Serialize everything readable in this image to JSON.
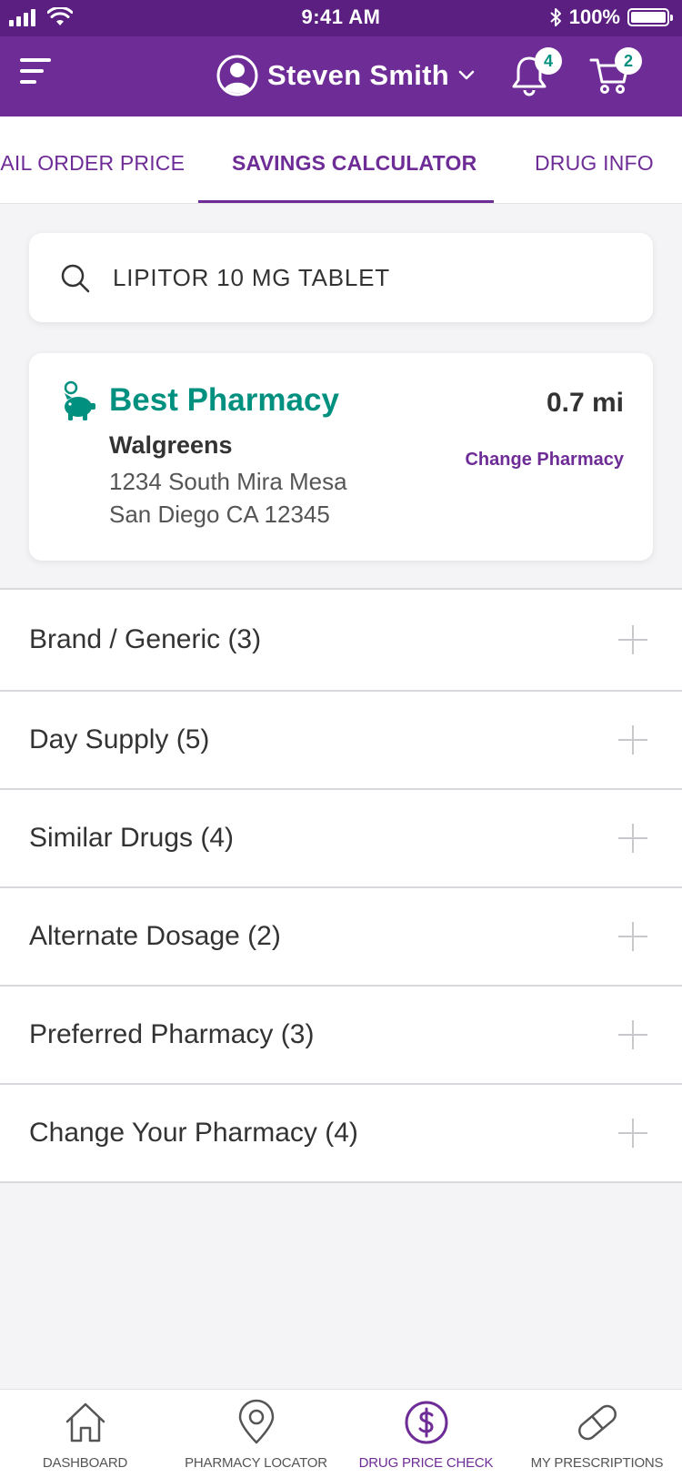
{
  "status_bar": {
    "time": "9:41 AM",
    "battery": "100%"
  },
  "header": {
    "user_name": "Steven Smith",
    "notification_count": "4",
    "cart_count": "2"
  },
  "tabs": [
    {
      "label": "MAIL ORDER PRICE",
      "active": false
    },
    {
      "label": "SAVINGS CALCULATOR",
      "active": true
    },
    {
      "label": "DRUG INFO",
      "active": false
    }
  ],
  "search": {
    "value": "LIPITOR 10 MG TABLET"
  },
  "pharmacy": {
    "heading": "Best Pharmacy",
    "distance": "0.7 mi",
    "name": "Walgreens",
    "address_line1": "1234 South Mira Mesa",
    "address_line2": "San Diego CA 12345",
    "change_label": "Change Pharmacy"
  },
  "accordion": [
    {
      "label": "Brand / Generic (3)"
    },
    {
      "label": "Day Supply (5)"
    },
    {
      "label": "Similar Drugs (4)"
    },
    {
      "label": "Alternate Dosage (2)"
    },
    {
      "label": "Preferred Pharmacy (3)"
    },
    {
      "label": "Change Your Pharmacy (4)"
    }
  ],
  "bottom_nav": [
    {
      "label": "DASHBOARD",
      "icon": "home-icon",
      "active": false
    },
    {
      "label": "PHARMACY LOCATOR",
      "icon": "location-pin-icon",
      "active": false
    },
    {
      "label": "DRUG PRICE CHECK",
      "icon": "dollar-circle-icon",
      "active": true
    },
    {
      "label": "MY PRESCRIPTIONS",
      "icon": "pill-icon",
      "active": false
    }
  ],
  "colors": {
    "brand_purple": "#6e2c96",
    "accent_teal": "#00907f"
  }
}
